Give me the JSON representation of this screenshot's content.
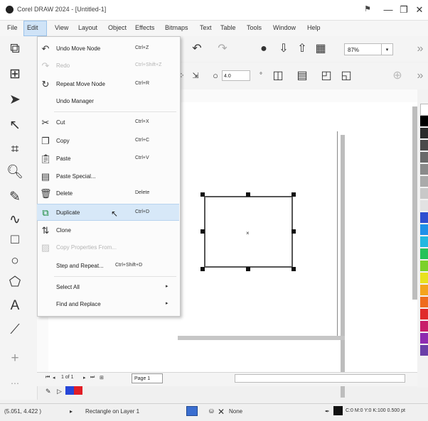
{
  "window": {
    "title": "Corel DRAW 2024 - [Untitled-1]",
    "controls": [
      "—",
      "❐",
      "✕"
    ]
  },
  "menubar": [
    "File",
    "Edit",
    "View",
    "Layout",
    "Object",
    "Effects",
    "Bitmaps",
    "Text",
    "Table",
    "Tools",
    "Window",
    "Help"
  ],
  "edit_menu": {
    "items": [
      {
        "label": "Undo Move Node",
        "shortcut": "Ctrl+Z",
        "icon": "undo-icon",
        "disabled": false
      },
      {
        "label": "Redo",
        "shortcut": "Ctrl+Shift+Z",
        "icon": "redo-icon",
        "disabled": true
      },
      {
        "label": "Repeat Move Node",
        "shortcut": "Ctrl+R",
        "icon": "repeat-icon",
        "disabled": false
      },
      {
        "label": "Undo Manager",
        "shortcut": "",
        "icon": "",
        "disabled": false
      },
      {
        "label": "Cut",
        "shortcut": "Ctrl+X",
        "icon": "cut-icon",
        "disabled": false
      },
      {
        "label": "Copy",
        "shortcut": "Ctrl+C",
        "icon": "copy-icon",
        "disabled": false
      },
      {
        "label": "Paste",
        "shortcut": "Ctrl+V",
        "icon": "paste-icon",
        "disabled": false
      },
      {
        "label": "Paste Special...",
        "shortcut": "",
        "icon": "paste-special-icon",
        "disabled": false
      },
      {
        "label": "Delete",
        "shortcut": "Delete",
        "icon": "delete-icon",
        "disabled": false
      },
      {
        "label": "Duplicate",
        "shortcut": "Ctrl+D",
        "icon": "duplicate-icon",
        "disabled": false
      },
      {
        "label": "Clone",
        "shortcut": "",
        "icon": "clone-icon",
        "disabled": false
      },
      {
        "label": "Copy Properties From...",
        "shortcut": "",
        "icon": "copy-properties-icon",
        "disabled": true
      },
      {
        "label": "Step and Repeat...",
        "shortcut": "Ctrl+Shift+D",
        "icon": "",
        "disabled": false
      },
      {
        "label": "Select All",
        "shortcut": "",
        "icon": "",
        "disabled": false,
        "submenu": true
      },
      {
        "label": "Find and Replace",
        "shortcut": "",
        "icon": "",
        "disabled": false,
        "submenu": true
      }
    ]
  },
  "toolbar": {
    "zoom": "87%",
    "size_w": "4.0",
    "undo_icon": "undo-icon",
    "redo_icon": "redo-icon"
  },
  "pager": {
    "page_count": "1 of 1",
    "page_tab": "Page 1"
  },
  "statusbar": {
    "coordinates": "(5.051, 4.422 )",
    "object_info": "Rectangle on Layer 1",
    "fill": "None",
    "outline": "C:0 M:0 Y:0 K:100 0.500 pt"
  },
  "palette_colors": [
    "#ffffff",
    "#000000",
    "#2b2b2b",
    "#4a4a4a",
    "#6a6a6a",
    "#8a8a8a",
    "#aaaaaa",
    "#c8c8c8",
    "#e2e2e2",
    "#2f4fd0",
    "#1e90e8",
    "#20b8e0",
    "#25c25a",
    "#7bd12a",
    "#e8e21f",
    "#f4a41d",
    "#ee6c1e",
    "#e02a2a",
    "#c81f6a",
    "#8e2bb0",
    "#6b3fa8"
  ]
}
